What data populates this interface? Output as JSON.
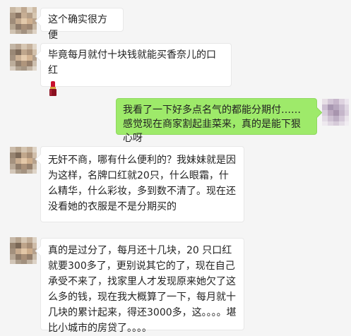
{
  "chat": {
    "messages": [
      {
        "side": "left",
        "text": "这个确实很方便"
      },
      {
        "side": "left",
        "text": "毕竟每月就付十块钱就能买香奈儿的口红",
        "emoji": "lipstick-emoji"
      },
      {
        "side": "right",
        "text": "我看了一下好多点名气的都能分期付……感觉现在商家割起韭菜来，真的是能下狠心呀"
      },
      {
        "side": "left",
        "text": "无奸不商，哪有什么便利的？我妹妹就是因为这样，名牌口红就20只，什么眼霜，什么精华，什么彩妆，多到数不清了。现在还没看她的衣服是不是分期买的"
      },
      {
        "side": "left",
        "text": "真的是过分了，每月还十几块，20 只口红就要300多了，更别说其它的了，现在自己承受不来了，找家里人才发现原来她欠了这么多的钱，现在我大概算了一下，每月就十几块的累计起来，得还3000多，这。。。。堪比小城市的房贷了。。。。"
      }
    ]
  },
  "colors": {
    "background": "#f5f5f5",
    "left_bubble": "#ffffff",
    "right_bubble": "#9eea6a"
  }
}
